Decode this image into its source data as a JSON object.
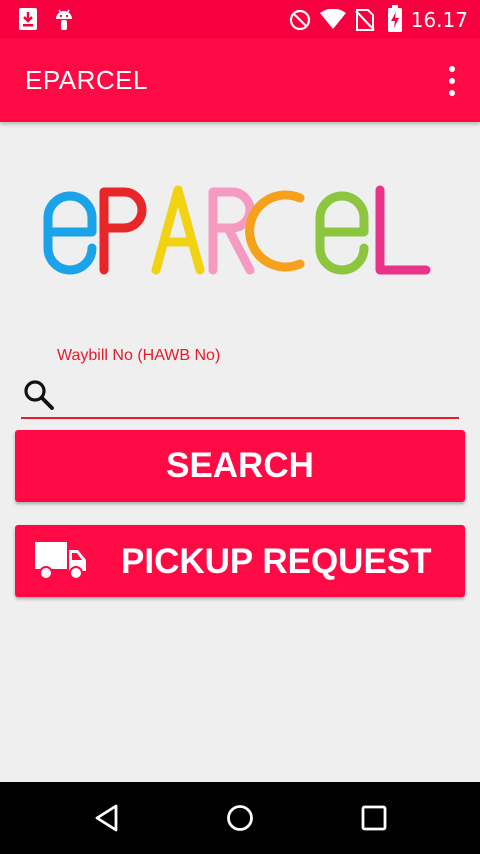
{
  "status_bar": {
    "time": "16.17",
    "icons": [
      "download-icon",
      "android-icon",
      "do-not-disturb-icon",
      "wifi-icon",
      "no-sim-icon",
      "battery-charging-icon"
    ]
  },
  "app_bar": {
    "title": "EPARCEL",
    "menu_icon": "more-vert-icon"
  },
  "logo": {
    "letters": [
      "e",
      "P",
      "A",
      "R",
      "C",
      "e",
      "L"
    ],
    "colors": [
      "#1aa3e8",
      "#e8262a",
      "#f2d313",
      "#f59ac0",
      "#f5a11b",
      "#8cc63f",
      "#e8338a"
    ]
  },
  "search": {
    "label": "Waybill No (HAWB No)",
    "placeholder": "",
    "value": "",
    "icon": "search-icon",
    "button_label": "SEARCH"
  },
  "pickup": {
    "button_label": "PICKUP REQUEST",
    "icon": "truck-icon"
  },
  "nav_bar": {
    "buttons": [
      "back-icon",
      "home-icon",
      "recents-icon"
    ]
  },
  "colors": {
    "primary": "#ff0a45",
    "status_bar": "#f7003f",
    "accent": "#e81b2a",
    "background": "#efefef"
  }
}
